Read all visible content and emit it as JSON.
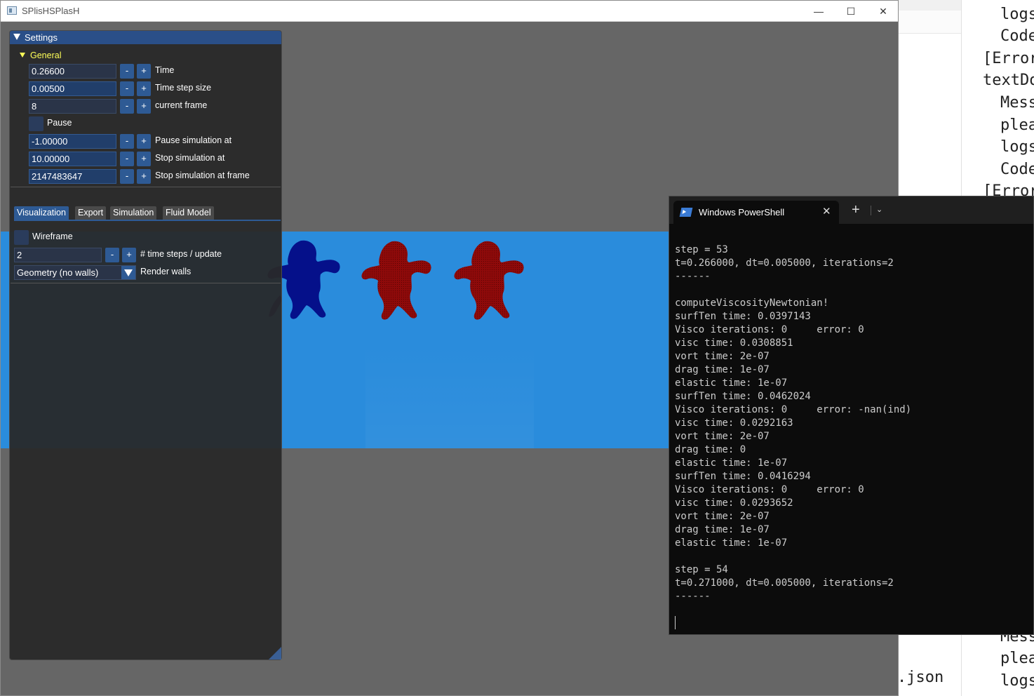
{
  "window": {
    "title": "SPlisHSPlasH",
    "minimize": "—",
    "maximize": "☐",
    "close": "✕"
  },
  "settings": {
    "title": "Settings",
    "general": {
      "label": "General",
      "time": {
        "value": "0.26600",
        "label": "Time"
      },
      "timestep": {
        "value": "0.00500",
        "label": "Time step size"
      },
      "frame": {
        "value": "8",
        "label": "current frame"
      },
      "pause": {
        "label": "Pause"
      },
      "pause_at": {
        "value": "-1.00000",
        "label": "Pause simulation at"
      },
      "stop_at": {
        "value": "10.00000",
        "label": "Stop simulation at"
      },
      "stop_frame": {
        "value": "2147483647",
        "label": "Stop simulation at frame"
      }
    },
    "minus": "-",
    "plus": "+",
    "tabs": [
      "Visualization",
      "Export",
      "Simulation",
      "Fluid Model"
    ],
    "visualization": {
      "wireframe": {
        "label": "Wireframe"
      },
      "steps": {
        "value": "2",
        "label": "# time steps / update"
      },
      "render_walls": {
        "value": "Geometry (no walls)",
        "label": "Render walls"
      }
    }
  },
  "colors": {
    "fluid": "#2a8cdc",
    "viewport_bg": "#666666",
    "monkey_blue": "#05108a",
    "monkey_red": "#8e0a0a",
    "panel_header": "#2a4f88",
    "accent_yellow": "#ffff58"
  },
  "powershell": {
    "tab_title": "Windows PowerShell",
    "tab_close": "✕",
    "new_tab": "+",
    "dropdown": "⌄",
    "console_lines": [
      "step = 53",
      "t=0.266000, dt=0.005000, iterations=2",
      "------",
      "",
      "computeViscosityNewtonian!",
      "surfTen time: 0.0397143",
      "Visco iterations: 0     error: 0",
      "visc time: 0.0308851",
      "vort time: 2e-07",
      "drag time: 1e-07",
      "elastic time: 1e-07",
      "surfTen time: 0.0462024",
      "Visco iterations: 0     error: -nan(ind)",
      "visc time: 0.0292163",
      "vort time: 2e-07",
      "drag time: 0",
      "elastic time: 1e-07",
      "surfTen time: 0.0416294",
      "Visco iterations: 0     error: 0",
      "visc time: 0.0293652",
      "vort time: 2e-07",
      "drag time: 1e-07",
      "elastic time: 1e-07",
      "",
      "step = 54",
      "t=0.271000, dt=0.005000, iterations=2",
      "------"
    ]
  },
  "background_editor": {
    "lines": [
      "logs",
      "Code",
      "[Error",
      "textDo",
      "Mess",
      "plea",
      "logs",
      "Code",
      "[Error"
    ],
    "bottom_lines": [
      "Mess",
      "plea",
      "logs"
    ],
    "json_text": ".json"
  }
}
